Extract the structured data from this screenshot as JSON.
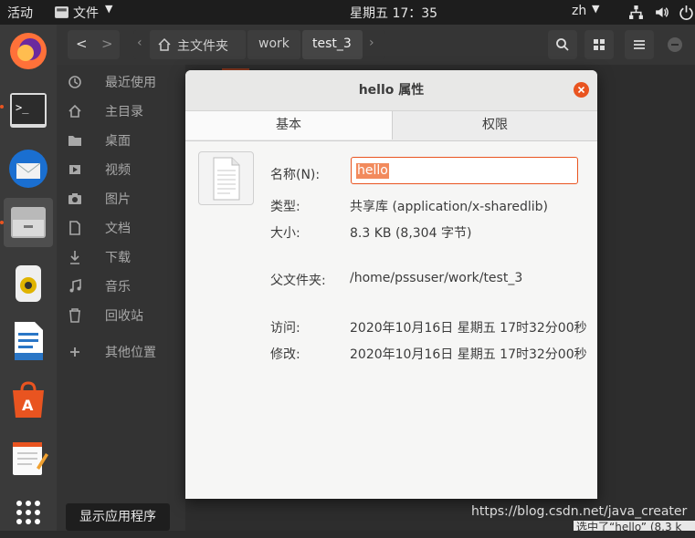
{
  "topbar": {
    "activities": "活动",
    "app_menu": "文件",
    "clock": "星期五 17：35",
    "lang": "zh"
  },
  "header": {
    "breadcrumb": [
      "主文件夹",
      "work",
      "test_3"
    ]
  },
  "sidebar": {
    "items": [
      {
        "label": "最近使用",
        "icon": "clock-icon"
      },
      {
        "label": "主目录",
        "icon": "home-icon"
      },
      {
        "label": "桌面",
        "icon": "folder-icon"
      },
      {
        "label": "视频",
        "icon": "video-icon"
      },
      {
        "label": "图片",
        "icon": "camera-icon"
      },
      {
        "label": "文档",
        "icon": "document-icon"
      },
      {
        "label": "下载",
        "icon": "download-icon"
      },
      {
        "label": "音乐",
        "icon": "music-icon"
      },
      {
        "label": "回收站",
        "icon": "trash-icon"
      },
      {
        "label": "其他位置",
        "icon": "plus-icon"
      }
    ]
  },
  "dialog": {
    "title": "hello 属性",
    "tabs": [
      "基本",
      "权限"
    ],
    "name_label": "名称(N):",
    "name_value": "hello",
    "type_label": "类型:",
    "type_value": "共享库 (application/x-sharedlib)",
    "size_label": "大小:",
    "size_value": "8.3 KB (8,304 字节)",
    "parent_label": "父文件夹:",
    "parent_value": "/home/pssuser/work/test_3",
    "access_label": "访问:",
    "access_value": "2020年10月16日 星期五 17时32分00秒",
    "modified_label": "修改:",
    "modified_value": "2020年10月16日 星期五 17时32分00秒"
  },
  "dock_tooltip": "显示应用程序",
  "watermark": "https://blog.csdn.net/java_creater",
  "statusbar": "选中了“hello” (8.3 k",
  "colors": {
    "accent": "#e95420",
    "topbar": "#1d1d1d",
    "dock": "#3a3a3a"
  }
}
